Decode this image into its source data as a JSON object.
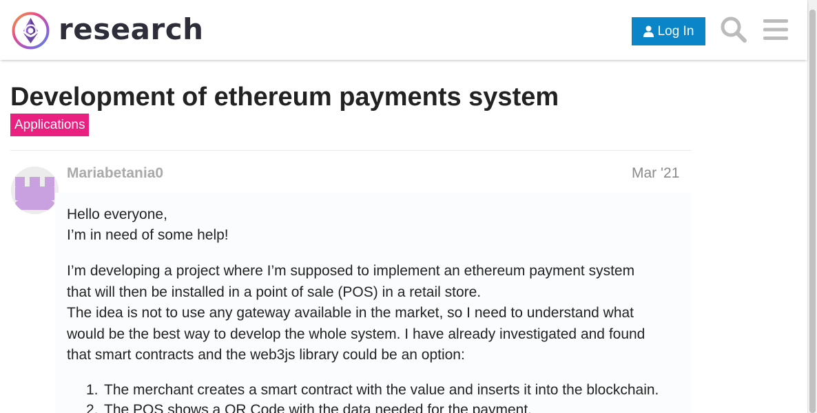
{
  "header": {
    "logo_text": "research",
    "login_label": "Log In",
    "search_icon": "search-icon",
    "menu_icon": "hamburger-menu-icon"
  },
  "topic": {
    "title": "Development of ethereum payments system",
    "category": "Applications",
    "category_color": "#e9207f"
  },
  "post": {
    "author": "Mariabetania0",
    "date": "Mar '21",
    "paragraphs": [
      "Hello everyone,",
      "I’m in need of some help!",
      "I’m developing a project where I’m supposed to implement an ethereum payment system",
      "that will then be installed in a point of sale (POS) in a retail store.",
      "The idea is not to use any gateway available in the market, so I need to understand what",
      "would be the best way to develop the whole system. I have already investigated and found",
      "that smart contracts and the web3js library could be an option:"
    ],
    "list": [
      {
        "num": "1.",
        "text": "The merchant creates a smart contract with the value and inserts it into the blockchain."
      },
      {
        "num": "2.",
        "text": "The POS shows a QR Code with the data needed for the payment."
      }
    ]
  },
  "colors": {
    "accent": "#0a86c8",
    "title": "#222222",
    "author": "#a9a9a9"
  }
}
